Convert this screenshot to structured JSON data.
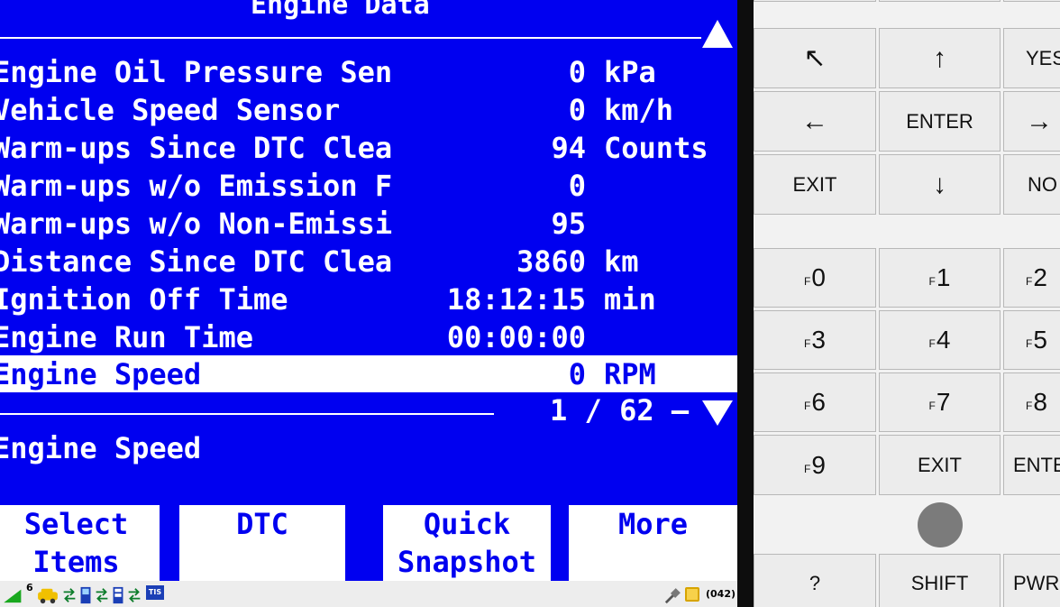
{
  "screen": {
    "title": "Engine Data",
    "rows": [
      {
        "name": "Engine Oil Pressure Sen",
        "value": "0",
        "unit": "kPa"
      },
      {
        "name": "Vehicle Speed Sensor",
        "value": "0",
        "unit": "km/h"
      },
      {
        "name": "Warm-ups Since DTC Clea",
        "value": "94",
        "unit": "Counts"
      },
      {
        "name": "Warm-ups w/o Emission F",
        "value": "0",
        "unit": ""
      },
      {
        "name": "Warm-ups w/o Non-Emissi",
        "value": "95",
        "unit": ""
      },
      {
        "name": "Distance Since DTC Clea",
        "value": "3860",
        "unit": "km"
      },
      {
        "name": "Ignition Off Time",
        "value": "18:12:15",
        "unit": "min"
      },
      {
        "name": "Engine Run Time",
        "value": "00:00:00",
        "unit": ""
      },
      {
        "name": "Engine Speed",
        "value": "0",
        "unit": "RPM"
      }
    ],
    "selected_index": 8,
    "pager": "1 / 62 –",
    "description": "Engine Speed",
    "softkeys": [
      {
        "line1": "Select",
        "line2": "Items"
      },
      {
        "line1": "DTC",
        "line2": ""
      },
      {
        "line1": "Quick",
        "line2": "Snapshot"
      },
      {
        "line1": "More",
        "line2": ""
      }
    ],
    "status": {
      "signal_number": "6",
      "tis_label": "TIS",
      "count": "(042)"
    }
  },
  "keypad": {
    "keys": {
      "up_left": "↖",
      "up": "↑",
      "yes": "YES",
      "left": "←",
      "enter": "ENTER",
      "right": "→",
      "exit": "EXIT",
      "down": "↓",
      "no": "NO",
      "f_prefix": "F",
      "f0": "0",
      "f1": "1",
      "f2": "2",
      "f3": "3",
      "f4": "4",
      "f5": "5",
      "f6": "6",
      "f7": "7",
      "f8": "8",
      "f9": "9",
      "exit2": "EXIT",
      "enter2": "ENTER",
      "help": "?",
      "shift": "SHIFT",
      "pwr": "PWR"
    }
  },
  "colors": {
    "screen_blue": "#0000f0",
    "text_white": "#ffffff",
    "keypad_bg": "#f2f2f2"
  }
}
